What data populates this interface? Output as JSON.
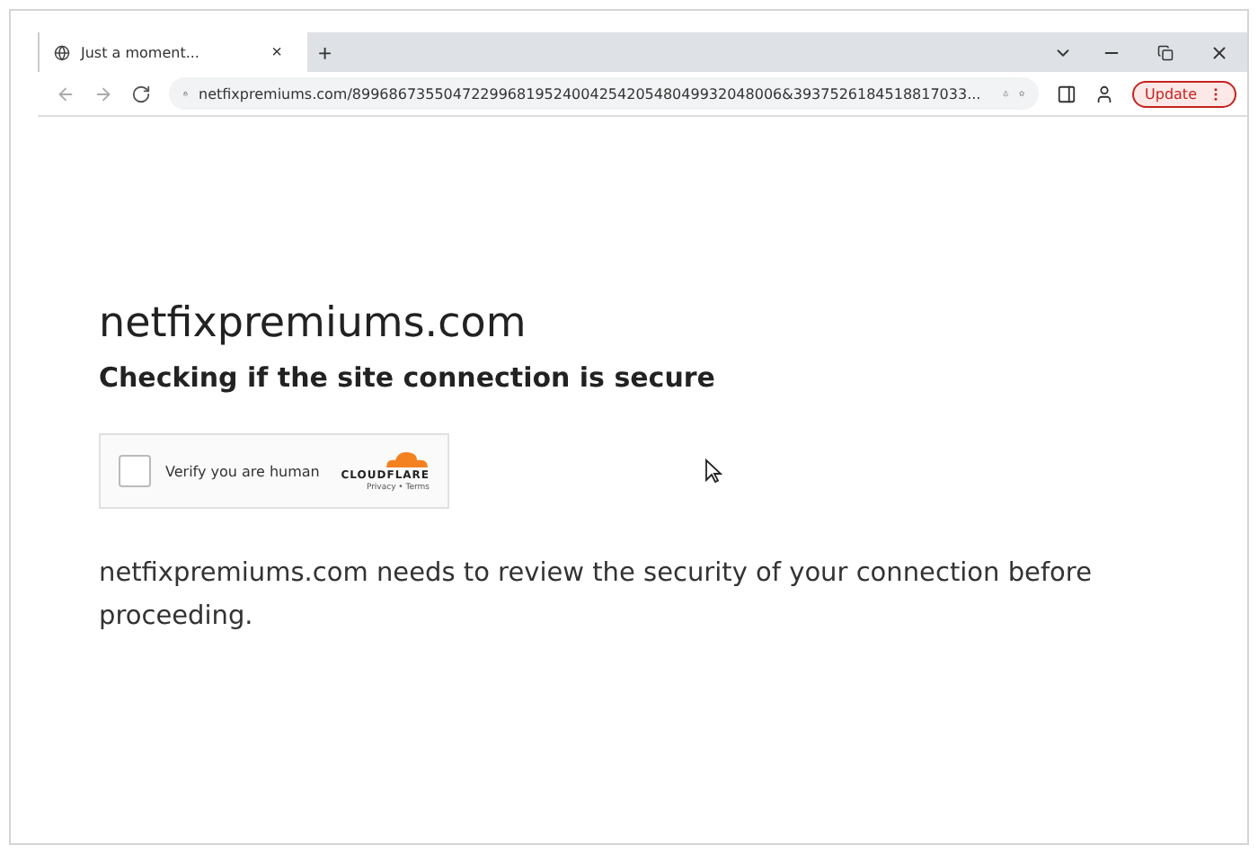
{
  "tab": {
    "title": "Just a moment...",
    "close": "×",
    "selected": true
  },
  "new_tab": "+",
  "address_bar": {
    "url": "netfixpremiums.com/89968673550472299681952400425420548049932048006&3937526184518817033..."
  },
  "update_button": {
    "label": "Update"
  },
  "page": {
    "heading": "netfixpremiums.com",
    "subheading": "Checking if the site connection is secure",
    "captcha": {
      "label": "Verify you are human",
      "checked": false,
      "brand": "CLOUDFLARE",
      "links": "Privacy • Terms"
    },
    "message": "netfixpremiums.com needs to review the security of your connection before proceeding."
  }
}
